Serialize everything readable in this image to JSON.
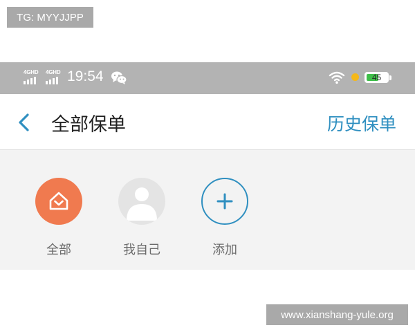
{
  "tg_badge": "TG: MYYJJPP",
  "status_bar": {
    "network_1": "4GHD",
    "network_2": "4GHD",
    "time": "19:54",
    "battery": "45",
    "icons": [
      "signal-icon",
      "wechat-icon",
      "wifi-icon",
      "sun-icon",
      "battery-icon"
    ]
  },
  "nav": {
    "title": "全部保单",
    "history_label": "历史保单",
    "back_icon": "chevron-left-icon"
  },
  "members": [
    {
      "label": "全部",
      "icon": "home-icon",
      "selected": true
    },
    {
      "label": "我自己",
      "icon": "person-avatar-icon",
      "selected": false
    },
    {
      "label": "添加",
      "icon": "plus-icon",
      "selected": false
    }
  ],
  "watermark": "www.xianshang-yule.org",
  "colors": {
    "accent": "#2f8fc0",
    "all_member": "#f07a4f",
    "status_bar": "#b3b3b3",
    "panel": "#f3f3f3",
    "battery_fill": "#3fbf4a"
  }
}
